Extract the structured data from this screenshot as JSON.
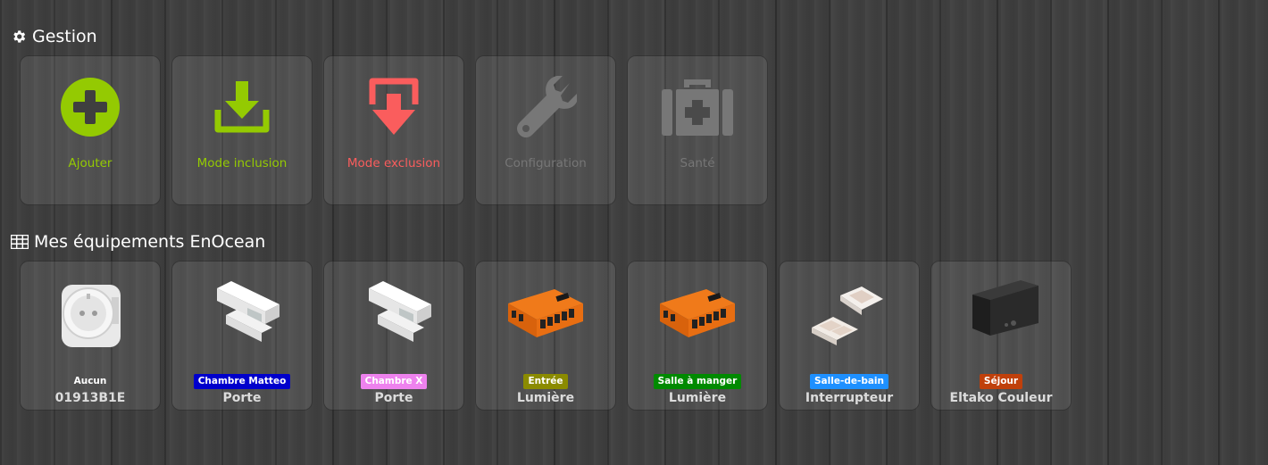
{
  "gestion": {
    "title": "Gestion",
    "items": [
      {
        "label": "Ajouter",
        "color": "#94ca02"
      },
      {
        "label": "Mode inclusion",
        "color": "#94ca02"
      },
      {
        "label": "Mode exclusion",
        "color": "#fa5d5d"
      },
      {
        "label": "Configuration",
        "color": "#767676"
      },
      {
        "label": "Santé",
        "color": "#767676"
      }
    ]
  },
  "equipements": {
    "title": "Mes équipements EnOcean",
    "items": [
      {
        "badge": "Aucun",
        "badge_color": "transparent",
        "name": "01913B1E",
        "image": "plug-socket"
      },
      {
        "badge": "Chambre Matteo",
        "badge_color": "#0000cc",
        "name": "Porte",
        "image": "door-sensor"
      },
      {
        "badge": "Chambre X",
        "badge_color": "#ee82ee",
        "name": "Porte",
        "image": "door-sensor"
      },
      {
        "badge": "Entrée",
        "badge_color": "#8b8b00",
        "name": "Lumière",
        "image": "relay-module"
      },
      {
        "badge": "Salle à manger",
        "badge_color": "#008a00",
        "name": "Lumière",
        "image": "relay-module"
      },
      {
        "badge": "Salle-de-bain",
        "badge_color": "#1e90ff",
        "name": "Interrupteur",
        "image": "wall-switch"
      },
      {
        "badge": "Séjour",
        "badge_color": "#c0400b",
        "name": "Eltako Couleur",
        "image": "eltako-box"
      }
    ]
  }
}
